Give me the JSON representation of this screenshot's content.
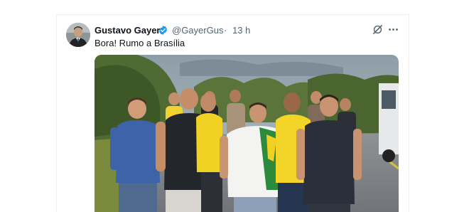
{
  "tweet": {
    "author_name": "Gustavo Gayer",
    "handle": "@GayerGus",
    "separator": "·",
    "timestamp": "13 h",
    "text": "Bora! Rumo a Brasília",
    "verified": true
  },
  "icons": {
    "verified": "verified-badge-icon",
    "grok": "grok-icon",
    "more": "more-options-icon"
  },
  "colors": {
    "verified_blue": "#1d9bf0",
    "text_primary": "#0f1419",
    "text_secondary": "#536471"
  }
}
